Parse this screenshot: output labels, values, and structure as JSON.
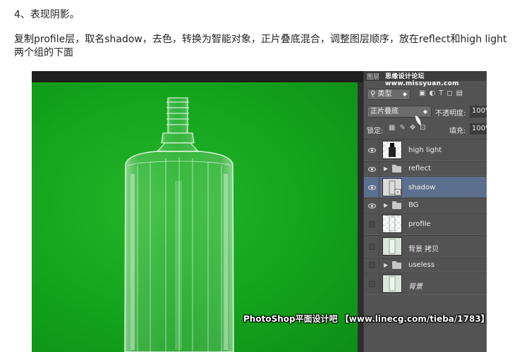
{
  "article": {
    "step_title": "4、表现阴影。",
    "paragraph": "复制profile层，取名shadow，去色，转换为智能对象，正片叠底混合，调整图层顺序，放在reflect和high light两个组的下面"
  },
  "layers_panel": {
    "title": "图层",
    "header_watermark": "思缘设计论坛 www.missyuan.com",
    "filter_kind": "类型",
    "filter_icon_names": [
      "image-filter-icon",
      "adjustment-filter-icon",
      "type-filter-icon",
      "shape-filter-icon",
      "smart-object-filter-icon"
    ],
    "blend_mode": "正片叠底",
    "opacity_label": "不透明度:",
    "opacity_value": "100%",
    "lock_label": "锁定:",
    "lock_icon_names": [
      "lock-transparent-icon",
      "lock-paint-icon",
      "lock-move-icon",
      "lock-all-icon"
    ],
    "fill_label": "填充:",
    "fill_value": "100%",
    "layers": [
      {
        "name": "high light",
        "type": "layer",
        "visible": true
      },
      {
        "name": "reflect",
        "type": "group",
        "visible": true
      },
      {
        "name": "shadow",
        "type": "smart-object",
        "visible": true,
        "selected": true
      },
      {
        "name": "BG",
        "type": "group",
        "visible": true
      },
      {
        "name": "profile",
        "type": "layer",
        "visible": false
      },
      {
        "name": "背景 拷贝",
        "type": "layer",
        "visible": false
      },
      {
        "name": "useless",
        "type": "group",
        "visible": false
      },
      {
        "name": "背景",
        "type": "layer",
        "visible": false,
        "italic": true
      }
    ]
  },
  "canvas": {
    "background_color": "#17a821"
  },
  "watermark": "PhotoShop平面设计吧 【www.linecg.com/tieba/1783】"
}
